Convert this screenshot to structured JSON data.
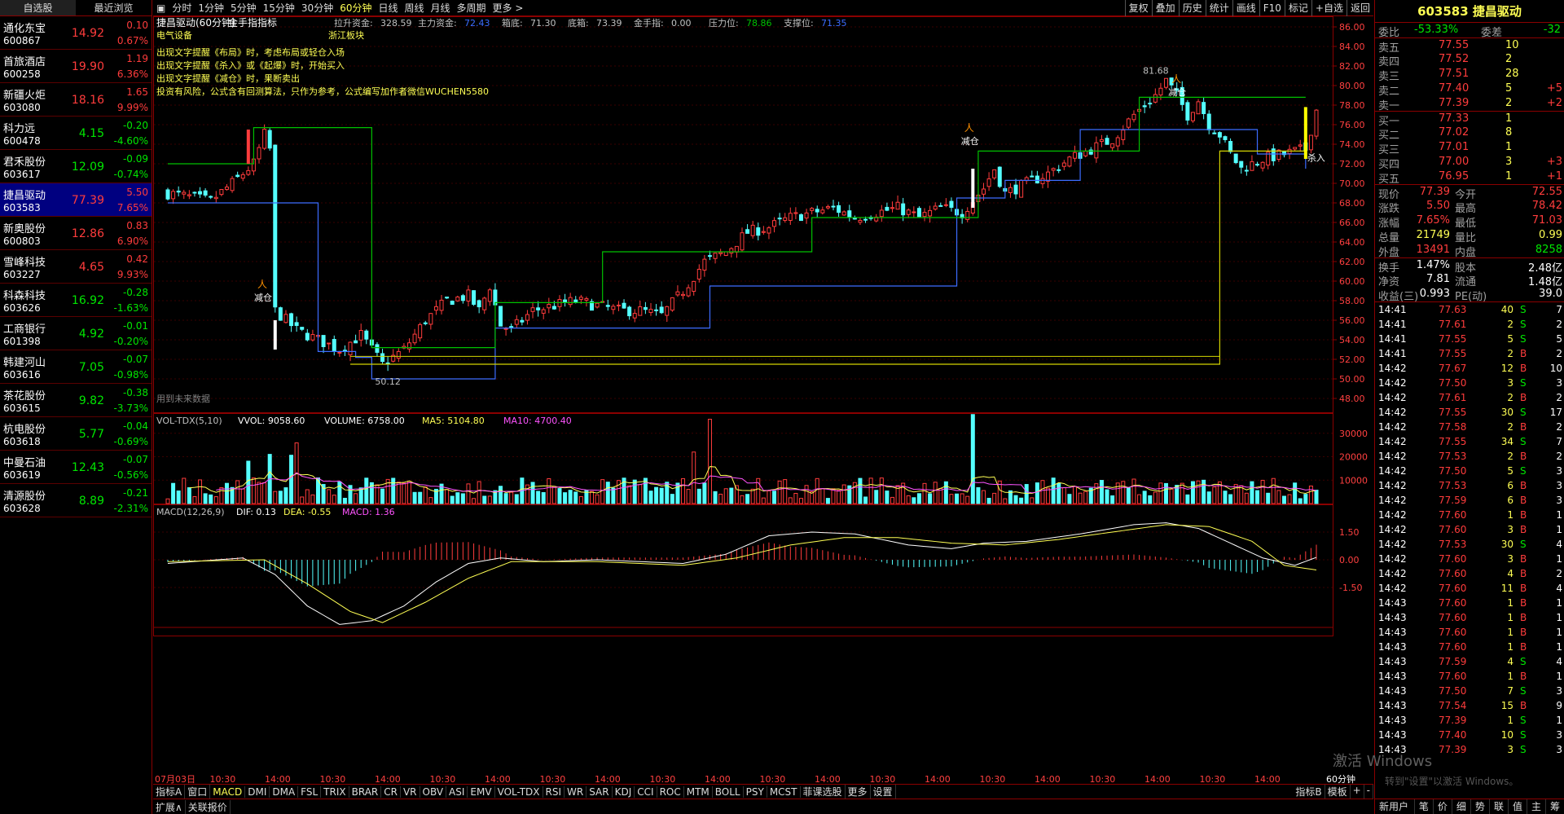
{
  "watchlist": {
    "tabs": [
      "自选股",
      "最近浏览"
    ],
    "items": [
      {
        "name": "通化东宝",
        "code": "600867",
        "price": "14.92",
        "chg": "0.10",
        "pct": "0.67%",
        "dir": "up"
      },
      {
        "name": "首旅酒店",
        "code": "600258",
        "price": "19.90",
        "chg": "1.19",
        "pct": "6.36%",
        "dir": "up"
      },
      {
        "name": "新疆火炬",
        "code": "603080",
        "price": "18.16",
        "chg": "1.65",
        "pct": "9.99%",
        "dir": "up"
      },
      {
        "name": "科力远",
        "code": "600478",
        "price": "4.15",
        "chg": "-0.20",
        "pct": "-4.60%",
        "dir": "down"
      },
      {
        "name": "君禾股份",
        "code": "603617",
        "price": "12.09",
        "chg": "-0.09",
        "pct": "-0.74%",
        "dir": "down"
      },
      {
        "name": "捷昌驱动",
        "code": "603583",
        "price": "77.39",
        "chg": "5.50",
        "pct": "7.65%",
        "dir": "up",
        "selected": true
      },
      {
        "name": "新奥股份",
        "code": "600803",
        "price": "12.86",
        "chg": "0.83",
        "pct": "6.90%",
        "dir": "up"
      },
      {
        "name": "雪峰科技",
        "code": "603227",
        "price": "4.65",
        "chg": "0.42",
        "pct": "9.93%",
        "dir": "up"
      },
      {
        "name": "科森科技",
        "code": "603626",
        "price": "16.92",
        "chg": "-0.28",
        "pct": "-1.63%",
        "dir": "down"
      },
      {
        "name": "工商银行",
        "code": "601398",
        "price": "4.92",
        "chg": "-0.01",
        "pct": "-0.20%",
        "dir": "down"
      },
      {
        "name": "韩建河山",
        "code": "603616",
        "price": "7.05",
        "chg": "-0.07",
        "pct": "-0.98%",
        "dir": "down"
      },
      {
        "name": "茶花股份",
        "code": "603615",
        "price": "9.82",
        "chg": "-0.38",
        "pct": "-3.73%",
        "dir": "down"
      },
      {
        "name": "杭电股份",
        "code": "603618",
        "price": "5.77",
        "chg": "-0.04",
        "pct": "-0.69%",
        "dir": "down"
      },
      {
        "name": "中曼石油",
        "code": "603619",
        "price": "12.43",
        "chg": "-0.07",
        "pct": "-0.56%",
        "dir": "down"
      },
      {
        "name": "清源股份",
        "code": "603628",
        "price": "8.89",
        "chg": "-0.21",
        "pct": "-2.31%",
        "dir": "down"
      }
    ]
  },
  "toolbar": {
    "periods": [
      "分时",
      "1分钟",
      "5分钟",
      "15分钟",
      "30分钟",
      "60分钟",
      "日线",
      "周线",
      "月线",
      "多周期",
      "更多 >"
    ],
    "active_period": "60分钟",
    "right": [
      "复权",
      "叠加",
      "历史",
      "统计",
      "画线",
      "F10",
      "标记",
      "+自选",
      "返回"
    ]
  },
  "chart": {
    "title": "捷昌驱动(60分钟)",
    "indicator_name": "金手指指标",
    "info": [
      {
        "label": "拉升资金:",
        "value": "328.59",
        "color": "#c0c0c0"
      },
      {
        "label": "主力资金:",
        "value": "72.43",
        "color": "#3c6cff"
      },
      {
        "label": "箱底:",
        "value": "71.30",
        "color": "#c0c0c0"
      },
      {
        "label": "底箱:",
        "value": "73.39",
        "color": "#c0c0c0"
      },
      {
        "label": "金手指:",
        "value": "0.00",
        "color": "#c0c0c0"
      },
      {
        "label": "压力位:",
        "value": "78.86",
        "color": "#00c000"
      },
      {
        "label": "支撑位:",
        "value": "71.35",
        "color": "#3c6cff"
      }
    ],
    "sector1": "电气设备",
    "sector2": "浙江板块",
    "notes": [
      "出现文字提醒《布局》时，考虑布局或轻仓入场",
      "出现文字提醒《杀入》或《起爆》时，开始买入",
      "出现文字提醒《减仓》时，果断卖出",
      "投资有风险，公式含有回测算法，只作为参考，公式编写加作者微信WUCHEN5580"
    ],
    "future_data_note": "用到未来数据",
    "signal_jiancang": "减仓",
    "signal_sharu": "杀入",
    "high_label": "81.68",
    "low_label": "50.12",
    "y_ticks": [
      "86.00",
      "84.00",
      "82.00",
      "80.00",
      "78.00",
      "76.00",
      "74.00",
      "72.00",
      "70.00",
      "68.00",
      "66.00",
      "64.00",
      "62.00",
      "60.00",
      "58.00",
      "56.00",
      "54.00",
      "52.00",
      "50.00",
      "48.00"
    ],
    "vol_legend": {
      "name": "VOL-TDX(5,10)",
      "vvol": "VVOL: 9058.60",
      "volume": "VOLUME: 6758.00",
      "ma5": "MA5: 5104.80",
      "ma10": "MA10: 4700.40"
    },
    "vol_ticks": [
      "30000",
      "20000",
      "10000"
    ],
    "macd_legend": {
      "name": "MACD(12,26,9)",
      "dif": "DIF: 0.13",
      "dea": "DEA: -0.55",
      "macd": "MACD: 1.36"
    },
    "macd_ticks": [
      "1.50",
      "0.00",
      "-1.50"
    ],
    "x_labels": [
      "07月03日",
      "10:30",
      "14:00",
      "10:30",
      "14:00",
      "10:30",
      "14:00",
      "10:30",
      "14:00",
      "10:30",
      "14:00",
      "10:30",
      "14:00",
      "10:30",
      "14:00",
      "10:30",
      "14:00",
      "10:30",
      "14:00",
      "10:30",
      "14:00"
    ],
    "period_label": "60分钟",
    "colors": {
      "up": "#ff3c3c",
      "down": "#54ffff",
      "grid": "#8b0000",
      "blue": "#3c6cff",
      "green": "#00c000",
      "yellow": "#d4d400"
    }
  },
  "indicator_bar": [
    "指标A",
    "窗口",
    "MACD",
    "DMI",
    "DMA",
    "FSL",
    "TRIX",
    "BRAR",
    "CR",
    "VR",
    "OBV",
    "ASI",
    "EMV",
    "VOL-TDX",
    "RSI",
    "WR",
    "SAR",
    "KDJ",
    "CCI",
    "ROC",
    "MTM",
    "BOLL",
    "PSY",
    "MCST",
    "菲课选股",
    "更多",
    "设置"
  ],
  "indicator_bar_right": [
    "指标B",
    "模板",
    "+",
    "-"
  ],
  "bottom_bar": [
    "扩展∧",
    "关联报价"
  ],
  "quote": {
    "title": "603583 捷昌驱动",
    "weibi_label": "委比",
    "weibi": "-53.33%",
    "weicha_label": "委差",
    "weicha": "-32",
    "asks": [
      {
        "label": "卖五",
        "price": "77.55",
        "vol": "10",
        "extra": ""
      },
      {
        "label": "卖四",
        "price": "77.52",
        "vol": "2",
        "extra": ""
      },
      {
        "label": "卖三",
        "price": "77.51",
        "vol": "28",
        "extra": ""
      },
      {
        "label": "卖二",
        "price": "77.40",
        "vol": "5",
        "extra": "+5"
      },
      {
        "label": "卖一",
        "price": "77.39",
        "vol": "2",
        "extra": "+2"
      }
    ],
    "bids": [
      {
        "label": "买一",
        "price": "77.33",
        "vol": "1",
        "extra": ""
      },
      {
        "label": "买二",
        "price": "77.02",
        "vol": "8",
        "extra": ""
      },
      {
        "label": "买三",
        "price": "77.01",
        "vol": "1",
        "extra": ""
      },
      {
        "label": "买四",
        "price": "77.00",
        "vol": "3",
        "extra": "+3"
      },
      {
        "label": "买五",
        "price": "76.95",
        "vol": "1",
        "extra": "+1"
      }
    ],
    "stats": [
      {
        "l1": "现价",
        "v1": "77.39",
        "c1": "red",
        "l2": "今开",
        "v2": "72.55",
        "c2": "red"
      },
      {
        "l1": "涨跌",
        "v1": "5.50",
        "c1": "red",
        "l2": "最高",
        "v2": "78.42",
        "c2": "red"
      },
      {
        "l1": "涨幅",
        "v1": "7.65%",
        "c1": "red",
        "l2": "最低",
        "v2": "71.03",
        "c2": "red"
      },
      {
        "l1": "总量",
        "v1": "21749",
        "c1": "yellow",
        "l2": "量比",
        "v2": "0.99",
        "c2": "yellow"
      },
      {
        "l1": "外盘",
        "v1": "13491",
        "c1": "red",
        "l2": "内盘",
        "v2": "8258",
        "c2": "green"
      }
    ],
    "stats2": [
      {
        "l1": "换手",
        "v1": "1.47%",
        "c1": "white",
        "l2": "股本",
        "v2": "2.48亿",
        "c2": "white"
      },
      {
        "l1": "净资",
        "v1": "7.81",
        "c1": "white",
        "l2": "流通",
        "v2": "1.48亿",
        "c2": "white"
      },
      {
        "l1": "收益(三)",
        "v1": "0.993",
        "c1": "white",
        "l2": "PE(动)",
        "v2": "39.0",
        "c2": "white"
      }
    ],
    "ticks": [
      {
        "t": "14:41",
        "p": "77.63",
        "v": "40",
        "s": "S",
        "n": "7"
      },
      {
        "t": "14:41",
        "p": "77.61",
        "v": "2",
        "s": "S",
        "n": "2"
      },
      {
        "t": "14:41",
        "p": "77.55",
        "v": "5",
        "s": "S",
        "n": "5"
      },
      {
        "t": "14:41",
        "p": "77.55",
        "v": "2",
        "s": "B",
        "n": "2"
      },
      {
        "t": "14:42",
        "p": "77.67",
        "v": "12",
        "s": "B",
        "n": "10"
      },
      {
        "t": "14:42",
        "p": "77.50",
        "v": "3",
        "s": "S",
        "n": "3"
      },
      {
        "t": "14:42",
        "p": "77.61",
        "v": "2",
        "s": "B",
        "n": "2"
      },
      {
        "t": "14:42",
        "p": "77.55",
        "v": "30",
        "s": "S",
        "n": "17"
      },
      {
        "t": "14:42",
        "p": "77.58",
        "v": "2",
        "s": "B",
        "n": "2"
      },
      {
        "t": "14:42",
        "p": "77.55",
        "v": "34",
        "s": "S",
        "n": "7"
      },
      {
        "t": "14:42",
        "p": "77.53",
        "v": "2",
        "s": "B",
        "n": "2"
      },
      {
        "t": "14:42",
        "p": "77.50",
        "v": "5",
        "s": "S",
        "n": "3"
      },
      {
        "t": "14:42",
        "p": "77.53",
        "v": "6",
        "s": "B",
        "n": "3"
      },
      {
        "t": "14:42",
        "p": "77.59",
        "v": "6",
        "s": "B",
        "n": "3"
      },
      {
        "t": "14:42",
        "p": "77.60",
        "v": "1",
        "s": "B",
        "n": "1"
      },
      {
        "t": "14:42",
        "p": "77.60",
        "v": "3",
        "s": "B",
        "n": "1"
      },
      {
        "t": "14:42",
        "p": "77.53",
        "v": "30",
        "s": "S",
        "n": "4"
      },
      {
        "t": "14:42",
        "p": "77.60",
        "v": "3",
        "s": "B",
        "n": "1"
      },
      {
        "t": "14:42",
        "p": "77.60",
        "v": "4",
        "s": "B",
        "n": "2"
      },
      {
        "t": "14:42",
        "p": "77.60",
        "v": "11",
        "s": "B",
        "n": "4"
      },
      {
        "t": "14:43",
        "p": "77.60",
        "v": "1",
        "s": "B",
        "n": "1"
      },
      {
        "t": "14:43",
        "p": "77.60",
        "v": "1",
        "s": "B",
        "n": "1"
      },
      {
        "t": "14:43",
        "p": "77.60",
        "v": "1",
        "s": "B",
        "n": "1"
      },
      {
        "t": "14:43",
        "p": "77.60",
        "v": "1",
        "s": "B",
        "n": "1"
      },
      {
        "t": "14:43",
        "p": "77.59",
        "v": "4",
        "s": "S",
        "n": "4"
      },
      {
        "t": "14:43",
        "p": "77.60",
        "v": "1",
        "s": "B",
        "n": "1"
      },
      {
        "t": "14:43",
        "p": "77.50",
        "v": "7",
        "s": "S",
        "n": "3"
      },
      {
        "t": "14:43",
        "p": "77.54",
        "v": "15",
        "s": "B",
        "n": "9"
      },
      {
        "t": "14:43",
        "p": "77.39",
        "v": "1",
        "s": "S",
        "n": "1"
      },
      {
        "t": "14:43",
        "p": "77.40",
        "v": "10",
        "s": "S",
        "n": "3"
      },
      {
        "t": "14:43",
        "p": "77.39",
        "v": "3",
        "s": "S",
        "n": "3"
      }
    ],
    "bottom_tabs": [
      "新用户福利专享",
      "笔",
      "价",
      "细",
      "势",
      "联",
      "值",
      "主",
      "筹"
    ]
  },
  "watermark": "激活 Windows",
  "watermark_sub": "转到\"设置\"以激活 Windows。"
}
